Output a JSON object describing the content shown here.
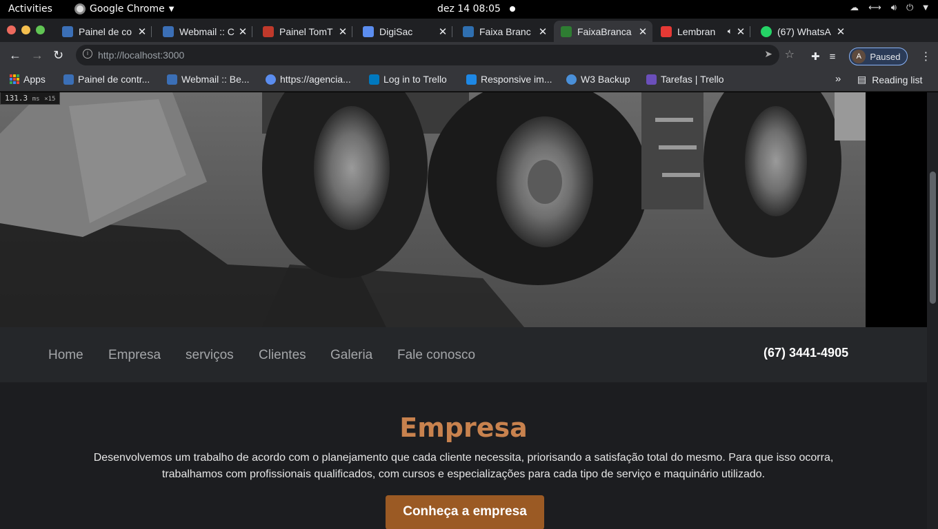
{
  "system": {
    "activities": "Activities",
    "app_name": "Google Chrome",
    "clock": "dez 14  08:05"
  },
  "tabs": [
    {
      "title": "Painel de co",
      "color": "#3b6fb6"
    },
    {
      "title": "Webmail :: C",
      "color": "#3b6fb6"
    },
    {
      "title": "Painel TomT",
      "color": "#c0392b"
    },
    {
      "title": "DigiSac",
      "color": "#5b8def"
    },
    {
      "title": "Faixa Branc",
      "color": "#2f6fb0"
    },
    {
      "title": "FaixaBranca",
      "color": "#2e7d32"
    },
    {
      "title": "Lembran",
      "color": "#e53935"
    },
    {
      "title": "(67) WhatsA",
      "color": "#25d366"
    }
  ],
  "toolbar": {
    "url": "http://localhost:3000",
    "profile_initial": "A",
    "profile_status": "Paused"
  },
  "bookmarks": [
    {
      "label": "Apps",
      "color": "#e8a33d"
    },
    {
      "label": "Painel de contr...",
      "color": "#3b6fb6"
    },
    {
      "label": "Webmail :: Be...",
      "color": "#3b6fb6"
    },
    {
      "label": "https://agencia...",
      "color": "#5b8def"
    },
    {
      "label": "Log in to Trello",
      "color": "#0079bf"
    },
    {
      "label": "Responsive im...",
      "color": "#1e88e5"
    },
    {
      "label": "W3 Backup",
      "color": "#4a90d9"
    },
    {
      "label": "Tarefas | Trello",
      "color": "#6b4fbb"
    }
  ],
  "reading_list": "Reading list",
  "perf": {
    "ms": "131.3",
    "unit": "ms",
    "mult": "×15"
  },
  "site": {
    "nav": [
      "Home",
      "Empresa",
      "serviços",
      "Clientes",
      "Galeria",
      "Fale conosco"
    ],
    "phone": "(67) 3441-4905",
    "section_title": "Empresa",
    "section_text": "Desenvolvemos um trabalho de acordo com o planejamento que cada cliente necessita, priorisando a satisfação total do mesmo. Para que isso ocorra, trabalhamos com profissionais qualificados, com cursos e especializações para cada tipo de serviço e maquinário utilizado.",
    "cta": "Conheça a empresa",
    "accent": "#c8824e",
    "button_color": "#9b5a24"
  }
}
